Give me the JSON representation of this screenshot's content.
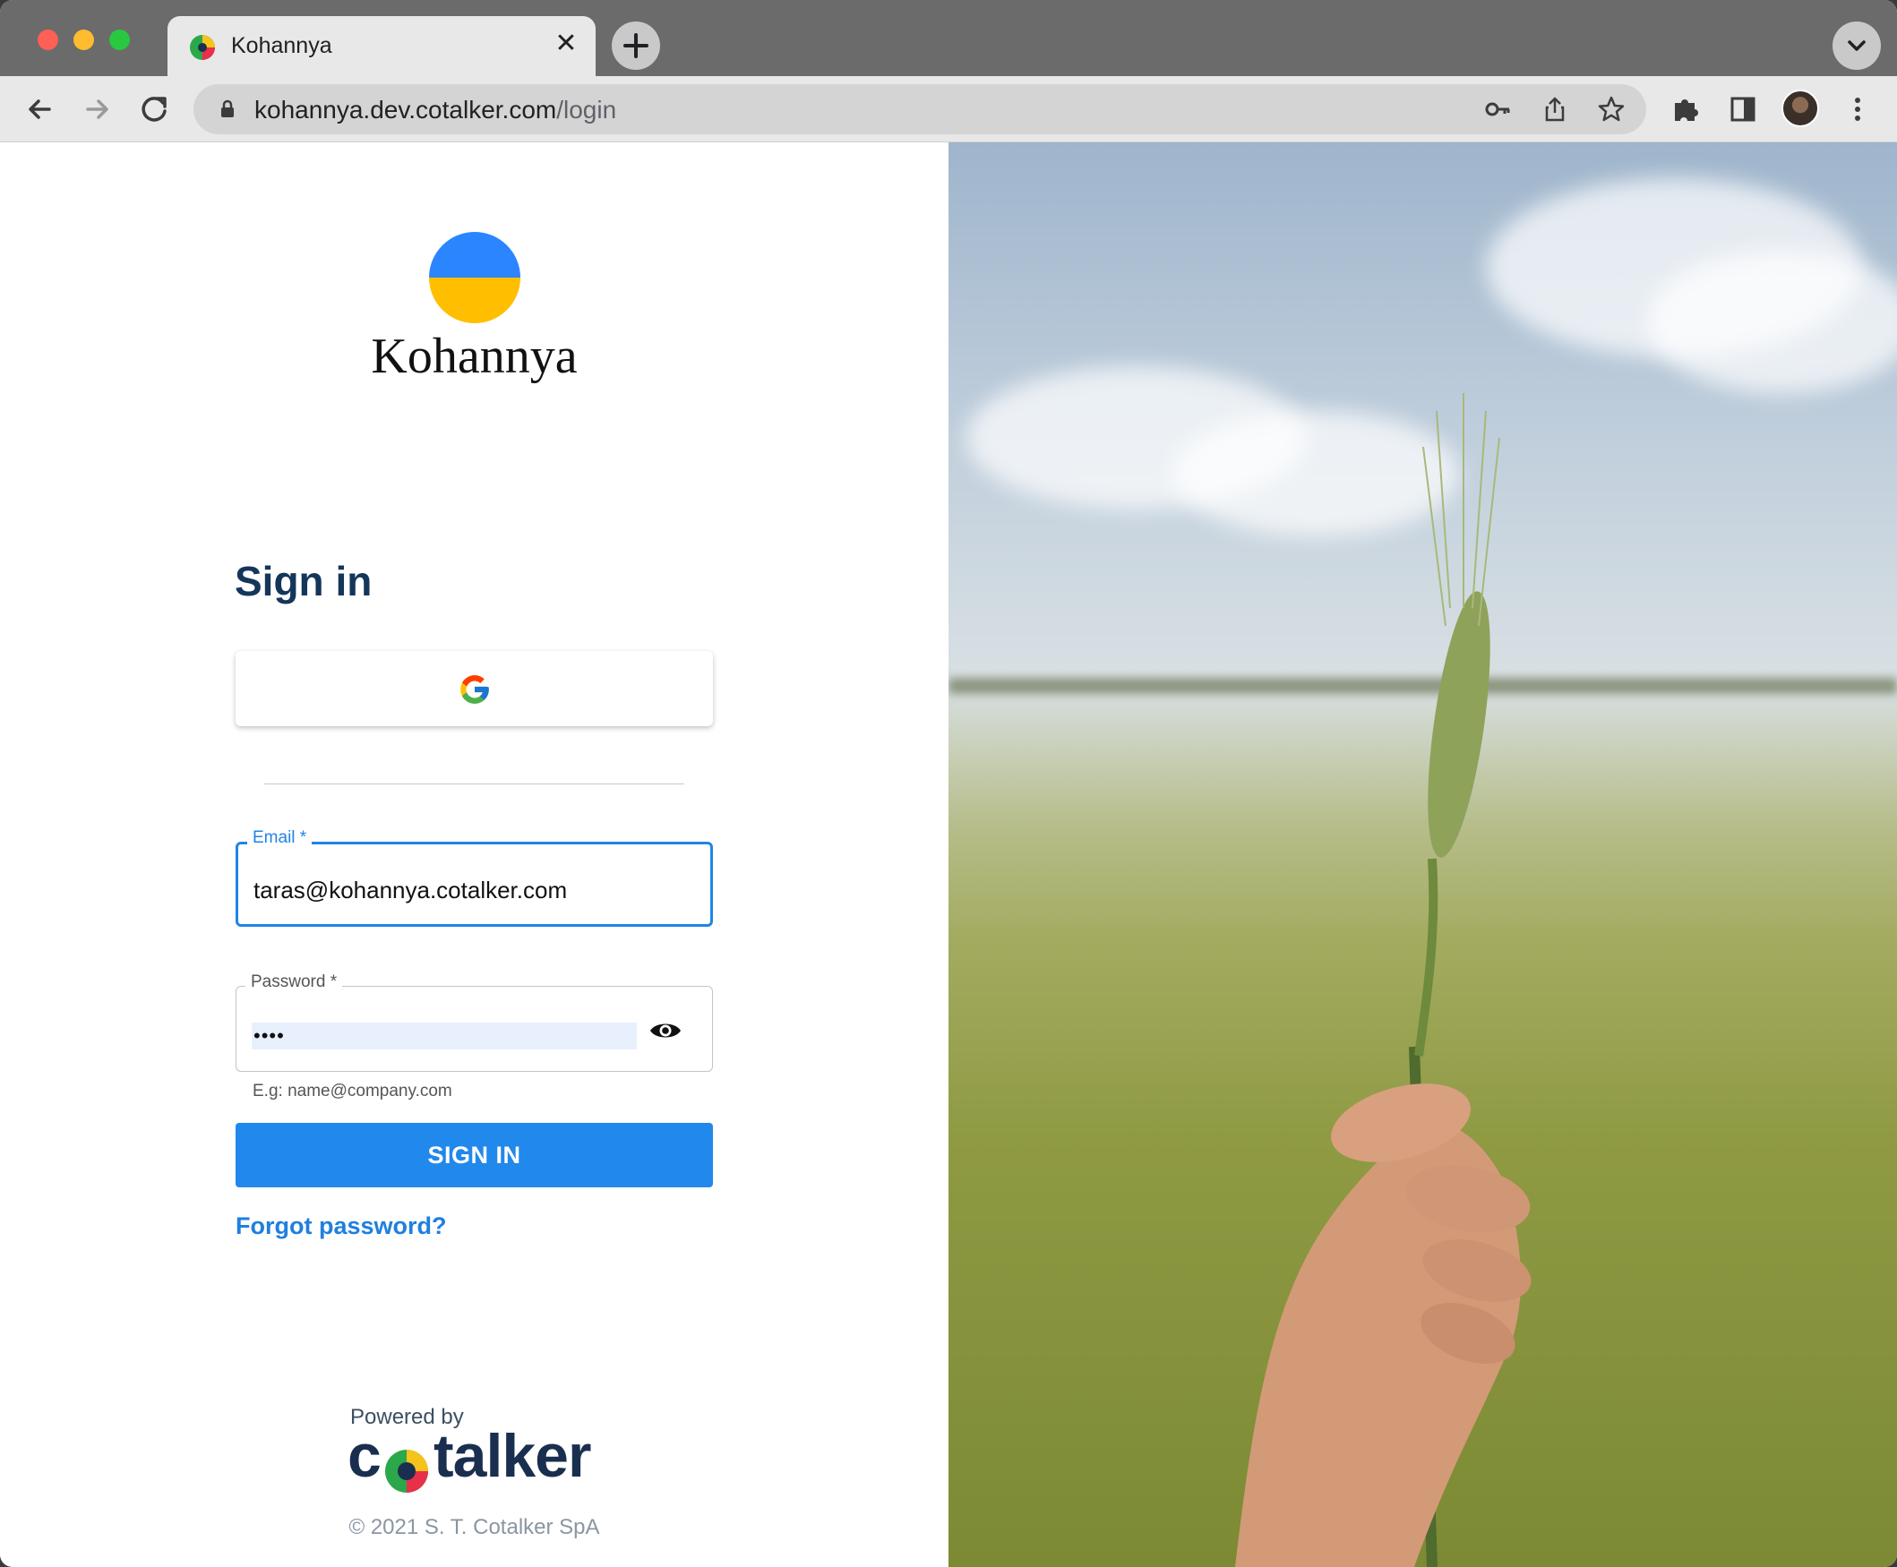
{
  "browser": {
    "tab_title": "Kohannya",
    "tab_close": "✕",
    "url_host": "kohannya.dev.cotalker.com",
    "url_path": "/login"
  },
  "brand": {
    "name": "Kohannya",
    "logo_colors": [
      "#2a85ff",
      "#ffbf00"
    ]
  },
  "login": {
    "title": "Sign in",
    "google_button": "google-icon",
    "email_label": "Email *",
    "email_value": "taras@kohannya.cotalker.com",
    "email_helper": "E.g: name@company.com",
    "password_label": "Password *",
    "password_value": "••••",
    "submit_label": "SIGN IN",
    "forgot_label": "Forgot password?"
  },
  "footer": {
    "powered_by": "Powered by",
    "logo_text_prefix": "c",
    "logo_text_suffix": "talker",
    "copyright": "© 2021 S. T. Cotalker SpA"
  },
  "colors": {
    "accent": "#2188ec",
    "title": "#14365a"
  }
}
